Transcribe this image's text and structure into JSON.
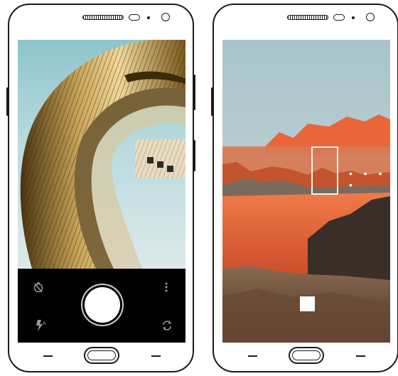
{
  "left_phone": {
    "camera": {
      "timer_icon": "timer-off-icon",
      "menu_icon": "more-vert-icon",
      "flash_icon": "flash-auto-icon",
      "switch_icon": "switch-camera-icon",
      "shutter_icon": "shutter-button"
    }
  },
  "right_phone": {
    "panorama": {
      "stop_icon": "stop-square-icon",
      "dots": "• • • •"
    }
  },
  "colors": {
    "phone_outline": "#1a1a1a",
    "controls_bg": "#000000",
    "icon_gray": "#9a9a9a",
    "sky": "#b9d8de",
    "mountain_orange": "#e8663a"
  }
}
